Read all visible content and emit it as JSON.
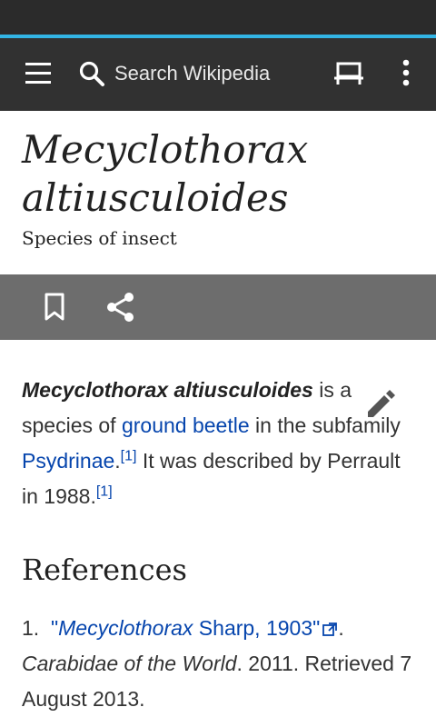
{
  "toolbar": {
    "search_placeholder": "Search Wikipedia",
    "icons": [
      "menu-icon",
      "search-icon",
      "reading-list-icon",
      "overflow-menu-icon"
    ]
  },
  "article": {
    "title_line1": "Mecyclothorax",
    "title_line2": "altiusculoides",
    "description": "Species of insect",
    "actions": [
      "bookmark-icon",
      "share-icon"
    ],
    "lead": {
      "bold_name": "Mecyclothorax altiusculoides",
      "t1": " is a species of ",
      "link_ground_beetle": "ground beetle",
      "t2": " in the subfamily ",
      "link_psydrinae": "Psydrinae",
      "t3": ".",
      "cite1": "[1]",
      "t4": " It was described by Perrault in 1988.",
      "cite2": "[1]"
    },
    "references_heading": "References",
    "reference": {
      "number": "1.",
      "quote_open": "\"",
      "link_genus": "Mecyclothorax",
      "link_rest": " Sharp, 1903\"",
      "after_link": ".",
      "source": "Carabidae of the World",
      "rest": ". 2011. Retrieved 7 August 2013."
    }
  },
  "colors": {
    "statusbar": "#2b2b2b",
    "accent": "#33b5e5",
    "toolbar": "#313131",
    "actionbar": "#6d6d6d",
    "link": "#0645ad"
  }
}
